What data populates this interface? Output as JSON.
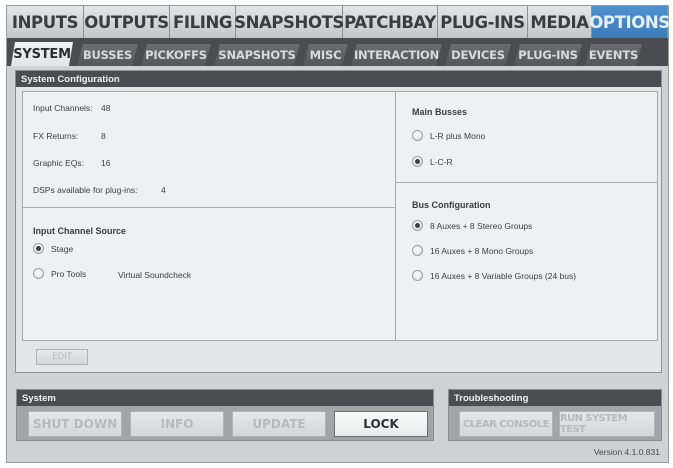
{
  "top_tabs": [
    {
      "label": "INPUTS",
      "active": false
    },
    {
      "label": "OUTPUTS",
      "active": false
    },
    {
      "label": "FILING",
      "active": false
    },
    {
      "label": "SNAPSHOTS",
      "active": false
    },
    {
      "label": "PATCHBAY",
      "active": false
    },
    {
      "label": "PLUG-INS",
      "active": false
    },
    {
      "label": "MEDIA",
      "active": false
    },
    {
      "label": "OPTIONS",
      "active": true
    }
  ],
  "sub_tabs": [
    {
      "label": "SYSTEM",
      "active": true
    },
    {
      "label": "BUSSES",
      "active": false
    },
    {
      "label": "PICKOFFS",
      "active": false
    },
    {
      "label": "SNAPSHOTS",
      "active": false
    },
    {
      "label": "MISC",
      "active": false
    },
    {
      "label": "INTERACTION",
      "active": false
    },
    {
      "label": "DEVICES",
      "active": false
    },
    {
      "label": "PLUG-INS",
      "active": false
    },
    {
      "label": "EVENTS",
      "active": false
    }
  ],
  "system_configuration": {
    "title": "System Configuration",
    "stats": [
      {
        "label": "Input Channels:",
        "value": "48"
      },
      {
        "label": "FX Returns:",
        "value": "8"
      },
      {
        "label": "Graphic EQs:",
        "value": "16"
      },
      {
        "label": "DSPs available for plug-ins:",
        "value": "4"
      }
    ],
    "input_channel_source": {
      "title": "Input Channel Source",
      "options": [
        {
          "label": "Stage",
          "selected": true
        },
        {
          "label": "Pro Tools",
          "selected": false
        }
      ],
      "virtual_soundcheck_label": "Virtual Soundcheck"
    },
    "main_busses": {
      "title": "Main Busses",
      "options": [
        {
          "label": "L-R plus Mono",
          "selected": false
        },
        {
          "label": "L-C-R",
          "selected": true
        }
      ]
    },
    "bus_configuration": {
      "title": "Bus Configuration",
      "options": [
        {
          "label": "8 Auxes + 8 Stereo Groups",
          "selected": true
        },
        {
          "label": "16 Auxes + 8 Mono Groups",
          "selected": false
        },
        {
          "label": "16 Auxes + 8 Variable Groups (24 bus)",
          "selected": false
        }
      ]
    },
    "edit_label": "EDIT"
  },
  "system_panel": {
    "title": "System",
    "buttons": [
      {
        "label": "SHUT DOWN",
        "enabled": false
      },
      {
        "label": "INFO",
        "enabled": false
      },
      {
        "label": "UPDATE",
        "enabled": false
      },
      {
        "label": "LOCK",
        "enabled": true
      }
    ]
  },
  "troubleshooting": {
    "title": "Troubleshooting",
    "buttons": [
      {
        "label": "CLEAR CONSOLE",
        "enabled": false
      },
      {
        "label": "RUN SYSTEM TEST",
        "enabled": false
      }
    ]
  },
  "version": "Version 4.1.0.831",
  "colors": {
    "active_tab": "#4a89c8",
    "panel_header": "#4b4d51",
    "background": "#cfd1d3"
  }
}
